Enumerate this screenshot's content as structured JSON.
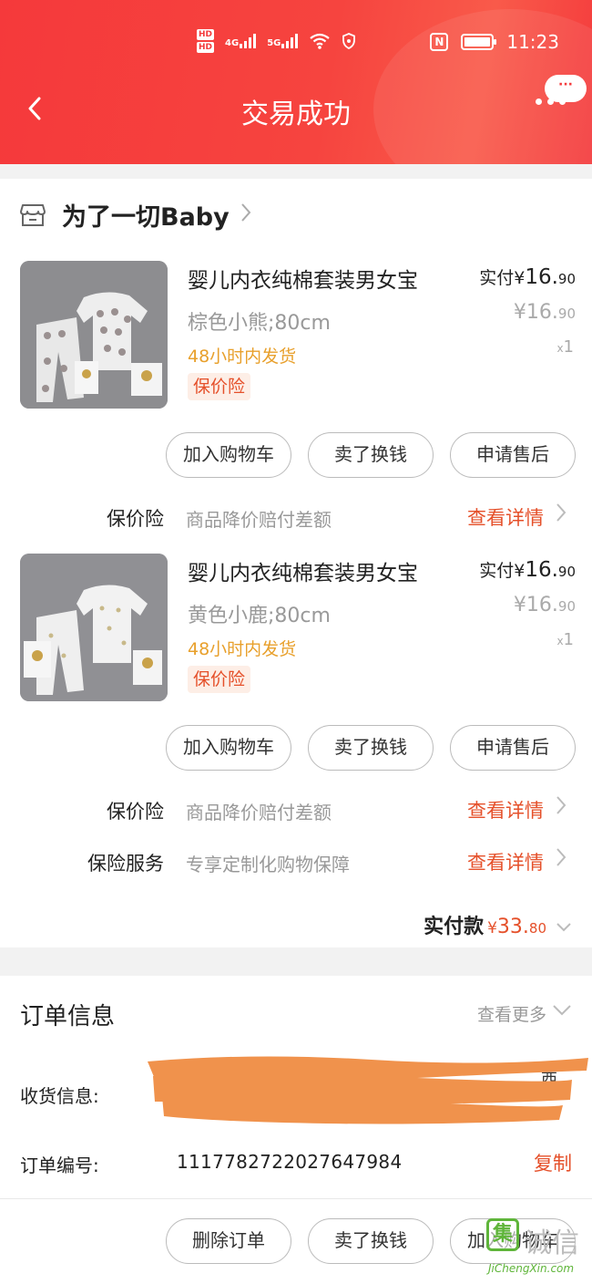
{
  "status_bar": {
    "hd1": "HD",
    "hd2": "HD",
    "net1": "4G",
    "net2": "5G",
    "nfc": "N",
    "time": "11:23"
  },
  "nav": {
    "title": "交易成功",
    "back_icon": "chevron-left-icon",
    "more_icon": "more-dots-icon",
    "message_bubble": "···"
  },
  "shop": {
    "name": "为了一切Baby",
    "store_icon": "store-icon"
  },
  "products": [
    {
      "title": "婴儿内衣纯棉套装男女宝",
      "variant": "棕色小熊;80cm",
      "shipping": "48小时内发货",
      "tag": "保价险",
      "paid_label": "实付",
      "paid_currency": "¥",
      "paid_amount": "16.",
      "paid_decimal": "90",
      "orig_currency": "¥",
      "orig_amount": "16.",
      "orig_decimal": "90",
      "qty_prefix": "x",
      "qty": "1",
      "image_theme": "#8f8f91"
    },
    {
      "title": "婴儿内衣纯棉套装男女宝",
      "variant": "黄色小鹿;80cm",
      "shipping": "48小时内发货",
      "tag": "保价险",
      "paid_label": "实付",
      "paid_currency": "¥",
      "paid_amount": "16.",
      "paid_decimal": "90",
      "orig_currency": "¥",
      "orig_amount": "16.",
      "orig_decimal": "90",
      "qty_prefix": "x",
      "qty": "1",
      "image_theme": "#909094"
    }
  ],
  "product_buttons": [
    "加入购物车",
    "卖了换钱",
    "申请售后"
  ],
  "insurance": [
    {
      "label": "保价险",
      "desc": "商品降价赔付差额",
      "link": "查看详情"
    },
    {
      "label": "保价险",
      "desc": "商品降价赔付差额",
      "link": "查看详情"
    },
    {
      "label": "保险服务",
      "desc": "专享定制化购物保障",
      "link": "查看详情"
    }
  ],
  "total": {
    "label": "实付款",
    "currency": "¥",
    "amount": "33.",
    "decimal": "80"
  },
  "order_info": {
    "title": "订单信息",
    "more": "查看更多",
    "address_label": "收货信息:",
    "address_tail": "西",
    "order_no_label": "订单编号:",
    "order_no": "1117782722027647984",
    "copy": "复制"
  },
  "bottom_buttons": [
    "删除订单",
    "卖了换钱",
    "加入购物车"
  ],
  "watermark": {
    "logo": "集",
    "text": "诚信",
    "url": "JiChengXin.com"
  },
  "colors": {
    "brand_red": "#f43a3c",
    "accent_orange": "#e5502a",
    "shipping_gold": "#e8a02c",
    "redaction": "#f0924c"
  }
}
